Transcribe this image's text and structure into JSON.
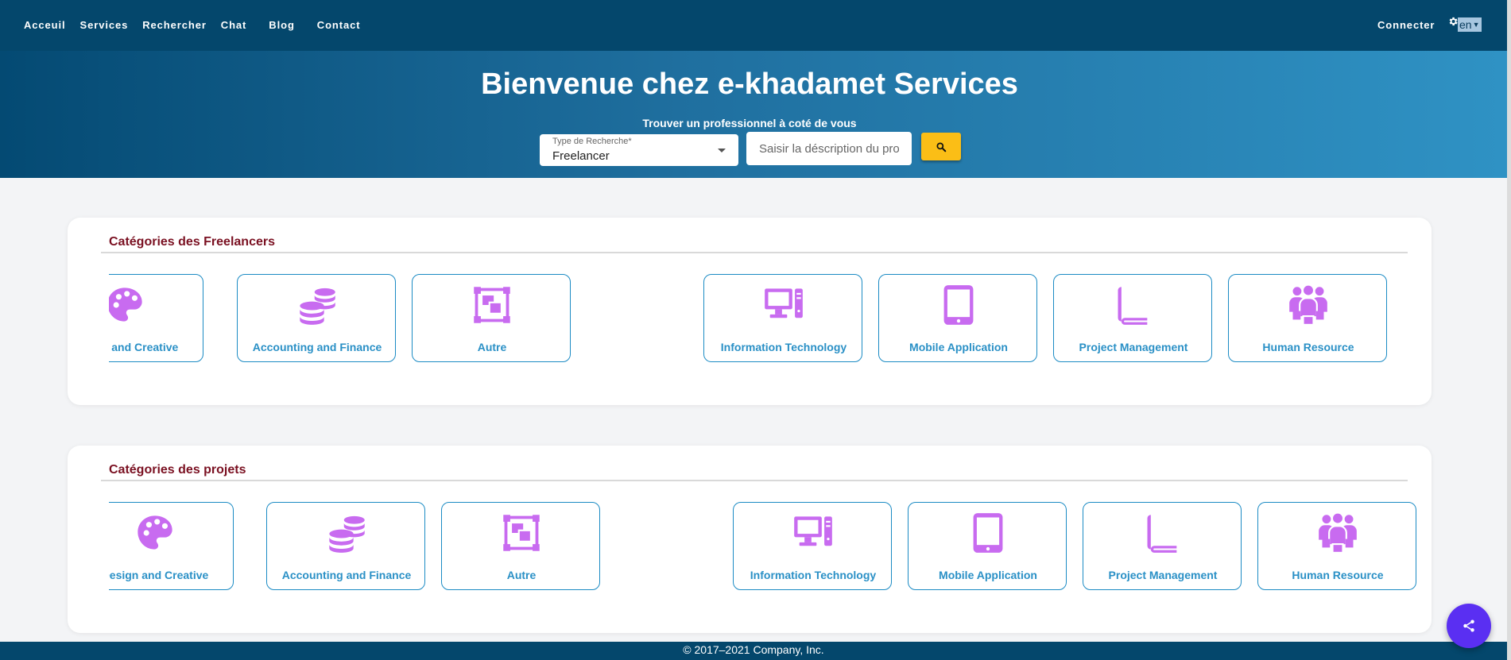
{
  "nav": {
    "items": [
      "Acceuil",
      "Services",
      "Rechercher",
      "Chat",
      "Blog",
      "Contact"
    ],
    "connect": "Connecter",
    "language": "en"
  },
  "hero": {
    "title": "Bienvenue chez e-khadamet Services",
    "subtitle": "Trouver un professionnel à coté de vous",
    "search_type_label": "Type de Recherche*",
    "search_type_value": "Freelancer",
    "search_placeholder": "Saisir la déscription du professionnel"
  },
  "freelancer_categories": {
    "title": "Catégories des Freelancers",
    "items": [
      {
        "label": "Design and Creative",
        "icon": "palette-icon"
      },
      {
        "label": "Accounting and Finance",
        "icon": "coins-icon"
      },
      {
        "label": "Autre",
        "icon": "object-group-icon"
      },
      {
        "label": "Information Technology",
        "icon": "desktop-tower-icon"
      },
      {
        "label": "Mobile Application",
        "icon": "tablet-icon"
      },
      {
        "label": "Project Management",
        "icon": "book-icon"
      },
      {
        "label": "Human Resource",
        "icon": "people-group-icon"
      }
    ]
  },
  "project_categories": {
    "title": "Catégories des projets",
    "items": [
      {
        "label": "Design and Creative",
        "icon": "palette-icon"
      },
      {
        "label": "Accounting and Finance",
        "icon": "coins-icon"
      },
      {
        "label": "Autre",
        "icon": "object-group-icon"
      },
      {
        "label": "Information Technology",
        "icon": "desktop-tower-icon"
      },
      {
        "label": "Mobile Application",
        "icon": "tablet-icon"
      },
      {
        "label": "Project Management",
        "icon": "book-icon"
      },
      {
        "label": "Human Resource",
        "icon": "people-group-icon"
      }
    ]
  },
  "footer": {
    "text": "© 2017–2021 Company, Inc."
  },
  "colors": {
    "header": "#04476c",
    "icon": "#c86bf0",
    "category_label": "#2a90c6",
    "section_title": "#7a1021",
    "search_button": "#fbbe16",
    "share_button": "#5a2ff2"
  }
}
